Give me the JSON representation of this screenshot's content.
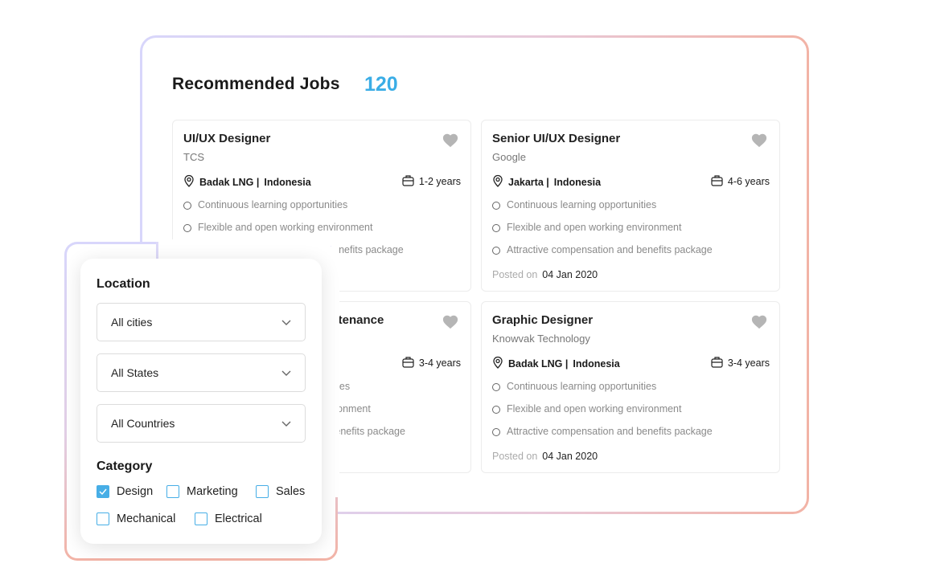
{
  "header": {
    "title": "Recommended Jobs",
    "count": "120"
  },
  "colors": {
    "accent": "#3aade6",
    "heart": "#b5b5b5"
  },
  "jobs": [
    {
      "title": "UI/UX Designer",
      "company": "TCS",
      "city": "Badak LNG |",
      "country": "Indonesia",
      "experience": "1-2 years",
      "benefits": [
        "Continuous learning opportunities",
        "Flexible and open working environment",
        "Attractive compensation and benefits package"
      ]
    },
    {
      "title": "Senior UI/UX Designer",
      "company": "Google",
      "city": "Jakarta |",
      "country": "Indonesia",
      "experience": "4-6 years",
      "benefits": [
        "Continuous learning opportunities",
        "Flexible and open working environment",
        "Attractive compensation and benefits package"
      ],
      "posted_label": "Posted on",
      "posted_date": "04 Jan 2020"
    },
    {
      "title": "aintenance",
      "experience": "3-4 years",
      "benefits": [
        "unities",
        "nvironment",
        "d benefits package"
      ]
    },
    {
      "title": "Graphic Designer",
      "company": "Knowvak Technology",
      "city": "Badak LNG |",
      "country": "Indonesia",
      "experience": "3-4 years",
      "benefits": [
        "Continuous learning opportunities",
        "Flexible and open working environment",
        "Attractive compensation and benefits package"
      ],
      "posted_label": "Posted on",
      "posted_date": "04 Jan 2020"
    }
  ],
  "filters": {
    "location_label": "Location",
    "selects": [
      "All cities",
      "All States",
      "All Countries"
    ],
    "category_label": "Category",
    "categories": [
      {
        "label": "Design",
        "checked": true
      },
      {
        "label": "Marketing",
        "checked": false
      },
      {
        "label": "Sales",
        "checked": false
      },
      {
        "label": "Mechanical",
        "checked": false
      },
      {
        "label": "Electrical",
        "checked": false
      }
    ]
  }
}
